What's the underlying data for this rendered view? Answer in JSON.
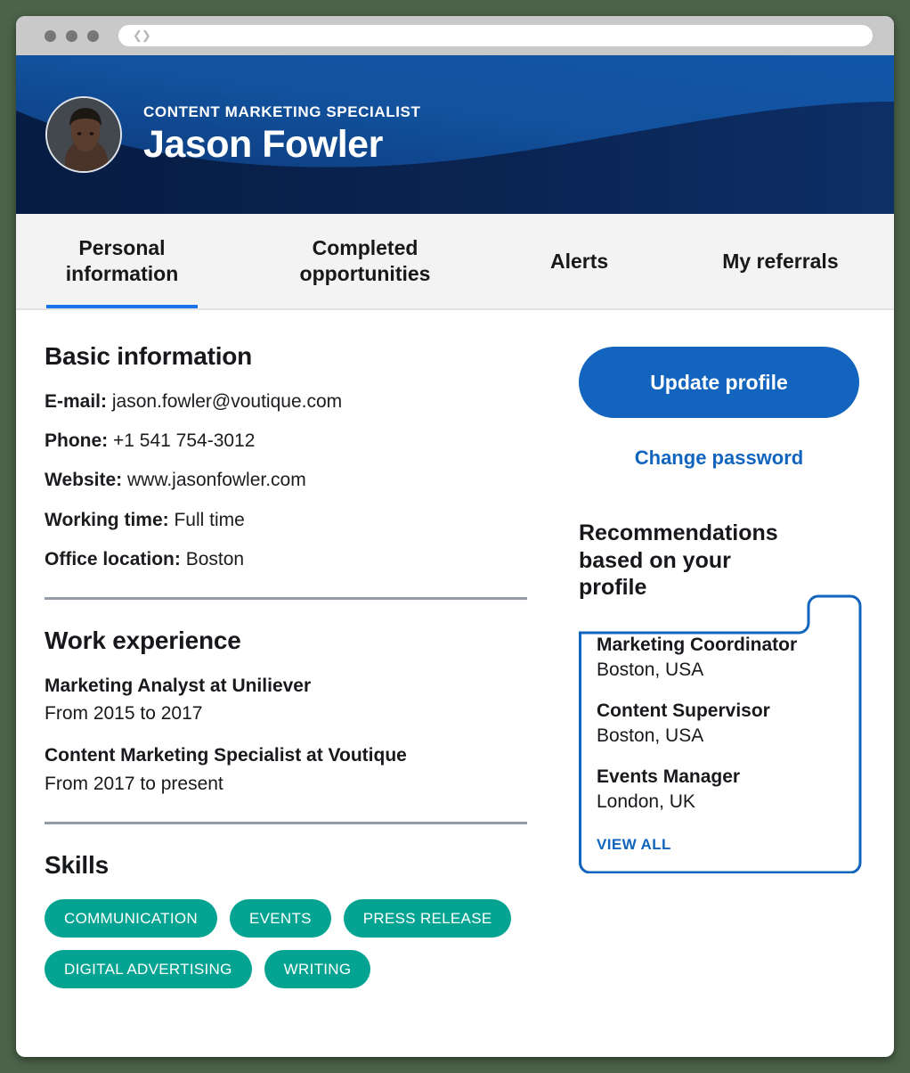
{
  "browser": {
    "traffic_lights": [
      "close",
      "minimize",
      "maximize"
    ],
    "address_nav_glyph": "‹›",
    "address_value": ""
  },
  "hero": {
    "role": "CONTENT MARKETING SPECIALIST",
    "name": "Jason Fowler",
    "bg_color": "#0a2452",
    "accent_color": "#13529e"
  },
  "tabs": [
    {
      "label_line1": "Personal",
      "label_line2": "information",
      "active": true
    },
    {
      "label_line1": "Completed",
      "label_line2": "opportunities",
      "active": false
    },
    {
      "label_line1": "Alerts",
      "label_line2": "",
      "active": false
    },
    {
      "label_line1": "My referrals",
      "label_line2": "",
      "active": false
    }
  ],
  "basic_information": {
    "title": "Basic information",
    "fields": [
      {
        "label": "E-mail:",
        "value": "jason.fowler@voutique.com"
      },
      {
        "label": "Phone:",
        "value": "+1 541 754-3012"
      },
      {
        "label": "Website:",
        "value": "www.jasonfowler.com"
      },
      {
        "label": "Working time:",
        "value": "Full time"
      },
      {
        "label": "Office location:",
        "value": "Boston"
      }
    ]
  },
  "work_experience": {
    "title": "Work experience",
    "jobs": [
      {
        "title": "Marketing Analyst at Uniliever",
        "dates": "From 2015 to 2017"
      },
      {
        "title": "Content Marketing Specialist at Voutique",
        "dates": "From 2017 to present"
      }
    ]
  },
  "skills": {
    "title": "Skills",
    "tag_color": "#05a392",
    "tags": [
      "COMMUNICATION",
      "EVENTS",
      "PRESS RELEASE",
      "DIGITAL ADVERTISING",
      "WRITING"
    ]
  },
  "actions": {
    "update_profile": "Update profile",
    "change_password": "Change password",
    "primary_color": "#1264be",
    "link_color": "#1265be"
  },
  "recommendations": {
    "heading_line1": "Recommendations",
    "heading_line2": "based on your profile",
    "border_color": "#1265be",
    "items": [
      {
        "title": "Marketing Coordinator",
        "location": "Boston, USA"
      },
      {
        "title": "Content Supervisor",
        "location": "Boston, USA"
      },
      {
        "title": "Events Manager",
        "location": "London, UK"
      }
    ],
    "view_all": "VIEW ALL"
  }
}
